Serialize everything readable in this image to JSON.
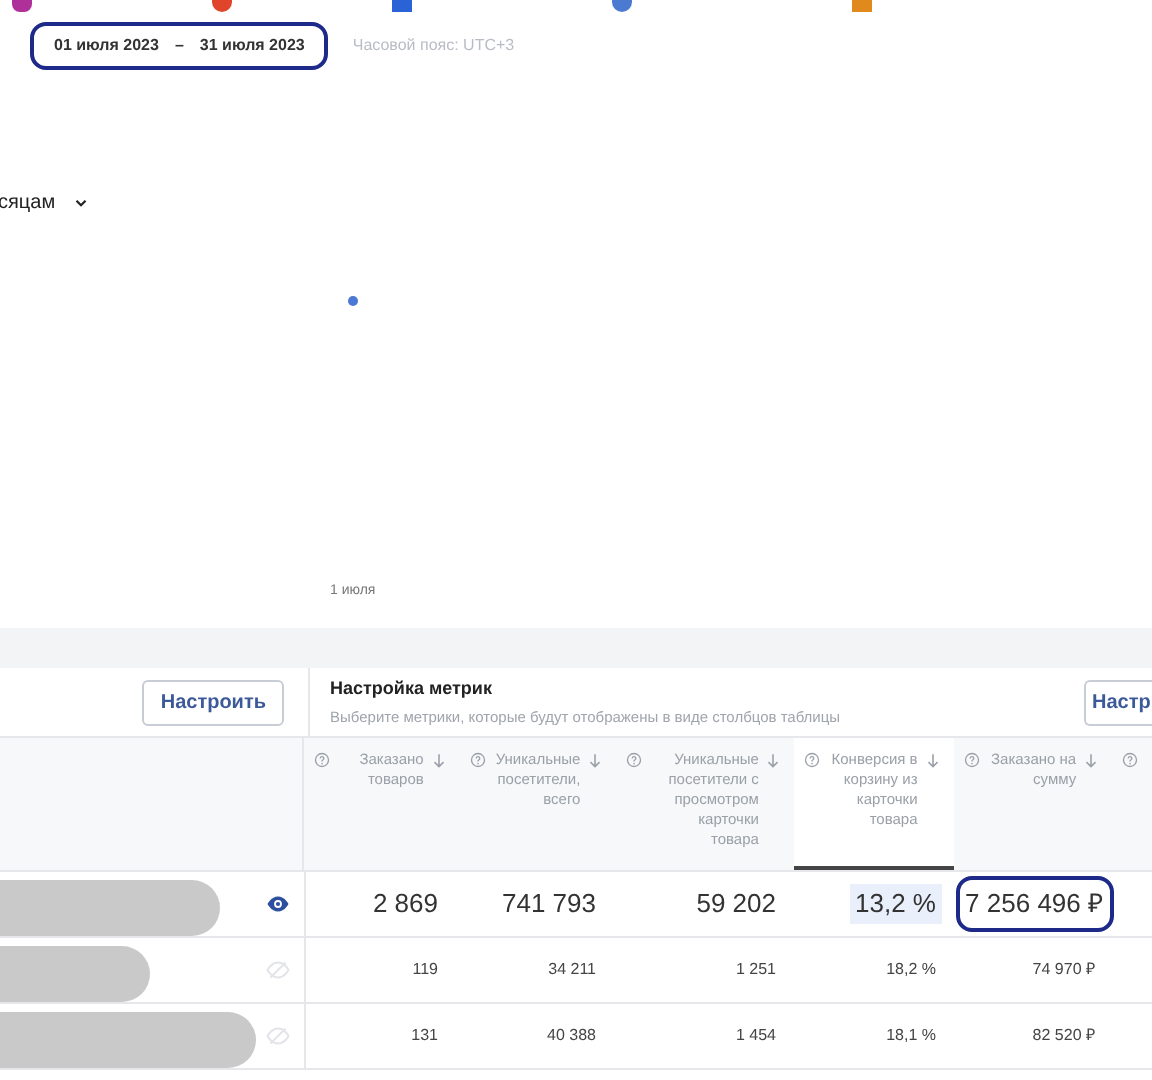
{
  "toolbar": {
    "date_from": "01 июля 2023",
    "date_separator": "–",
    "date_to": "31 июля 2023",
    "date_circled": true,
    "timezone": "Часовой пояс: UTC+3"
  },
  "grouping": {
    "value": "сяцам"
  },
  "chart": {
    "x_label": "1 июля"
  },
  "settings": {
    "button": "Настроить",
    "title": "Настройка метрик",
    "subtitle": "Выберите метрики, которые будут отображены в виде столбцов таблицы",
    "button_cut": "Настр"
  },
  "table": {
    "columns": [
      {
        "kind": "metric",
        "label": "Заказано товаров",
        "selected": false
      },
      {
        "kind": "metric",
        "label": "Уникальные посетители, всего",
        "selected": false
      },
      {
        "kind": "metric",
        "label": "Уникальные посетители с просмотром карточки товара",
        "selected": false
      },
      {
        "kind": "metric",
        "label": "Конверсия в корзину из карточки товара",
        "selected": true
      },
      {
        "kind": "metric",
        "label": "Заказано на сумму",
        "selected": false
      },
      {
        "kind": "cut",
        "selected": false
      }
    ],
    "rows": [
      {
        "kind": "total",
        "visible": true,
        "redacted": true,
        "cells": [
          {
            "text": "2 869",
            "circled": false
          },
          {
            "text": "741 793",
            "circled": false
          },
          {
            "text": "59 202",
            "circled": false
          },
          {
            "text": "13,2 %",
            "circled": false
          },
          {
            "text": "7 256 496 ₽",
            "circled": true
          }
        ]
      },
      {
        "kind": "item",
        "visible": false,
        "redacted": true,
        "cells": [
          {
            "text": "119",
            "circled": false
          },
          {
            "text": "34 211",
            "circled": false
          },
          {
            "text": "1 251",
            "circled": false
          },
          {
            "text": "18,2 %",
            "circled": false
          },
          {
            "text": "74 970 ₽",
            "circled": false
          }
        ]
      },
      {
        "kind": "item",
        "visible": false,
        "redacted": true,
        "cells": [
          {
            "text": "131",
            "circled": false
          },
          {
            "text": "40 388",
            "circled": false
          },
          {
            "text": "1 454",
            "circled": false
          },
          {
            "text": "18,1 %",
            "circled": false
          },
          {
            "text": "82 520 ₽",
            "circled": false
          }
        ]
      }
    ]
  }
}
